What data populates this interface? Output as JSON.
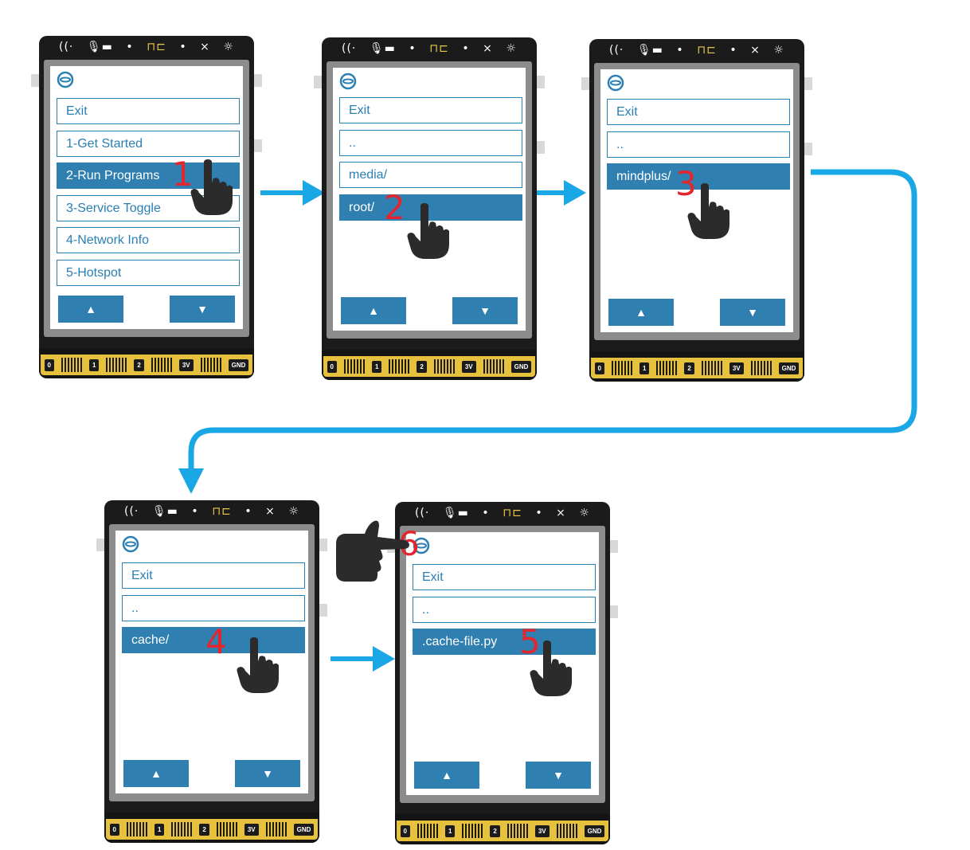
{
  "sensor_strip": {
    "icons": [
      "wifi-icon",
      "mic-icon",
      "light-icon",
      "sensor-icon",
      "dot-icon",
      "buzzer-icon",
      "sun-icon"
    ]
  },
  "pins": [
    "0",
    "1",
    "2",
    "3V",
    "GND"
  ],
  "buttons": {
    "up": "▲",
    "down": "▼"
  },
  "colors": {
    "accent": "#2f7fb0",
    "arrow": "#1aa7e6",
    "step_number": "#e3262e"
  },
  "screens": [
    {
      "items": [
        "Exit",
        "1-Get Started",
        "2-Run Programs",
        "3-Service Toggle",
        "4-Network Info",
        "5-Hotspot"
      ],
      "selected": 2,
      "step": "1"
    },
    {
      "items": [
        "Exit",
        "..",
        "media/",
        "root/"
      ],
      "selected": 3,
      "step": "2"
    },
    {
      "items": [
        "Exit",
        "..",
        "mindplus/"
      ],
      "selected": 2,
      "step": "3"
    },
    {
      "items": [
        "Exit",
        "..",
        "cache/"
      ],
      "selected": 2,
      "step": "4"
    },
    {
      "items": [
        "Exit",
        "..",
        ".cache-file.py"
      ],
      "selected": 2,
      "step": "5",
      "logo_step": "6"
    }
  ]
}
